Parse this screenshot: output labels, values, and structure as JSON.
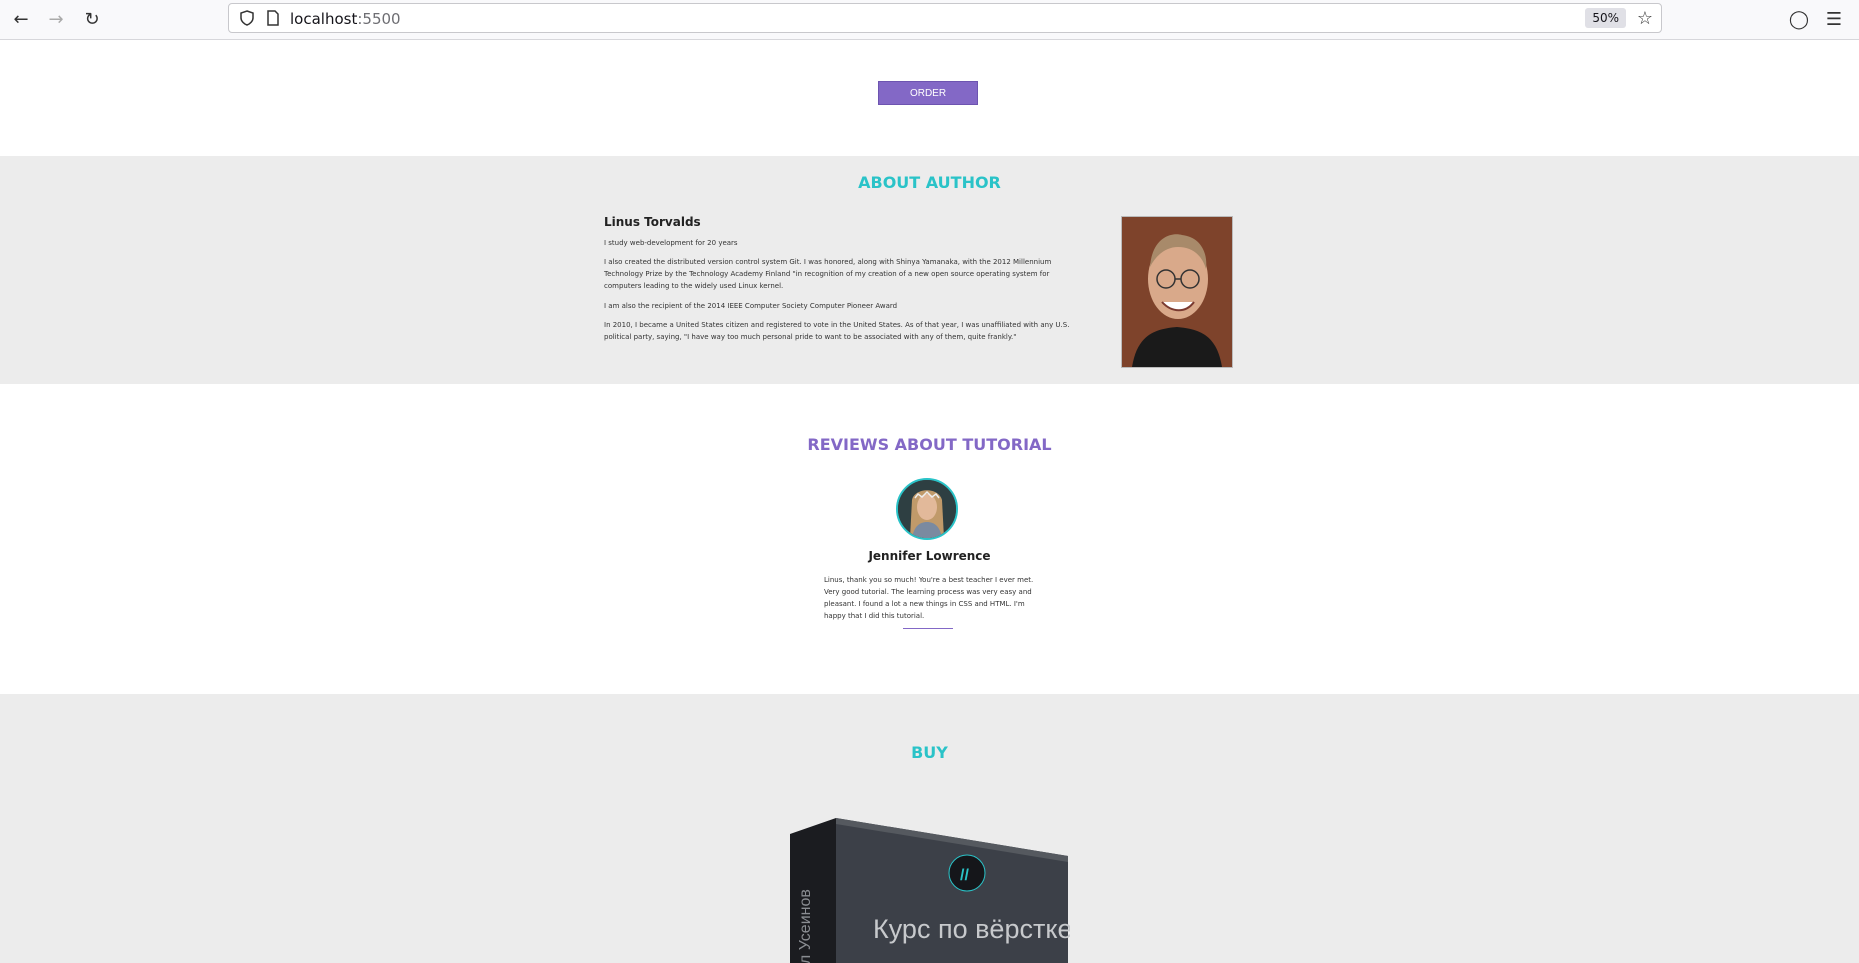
{
  "browser": {
    "url_host": "localhost",
    "url_port": ":5500",
    "zoom": "50%"
  },
  "order": {
    "label": "ORDER"
  },
  "about": {
    "title": "ABOUT AUTHOR",
    "name": "Linus Torvalds",
    "paragraphs": [
      "I study web-development for 20 years",
      "I also created the distributed version control system Git. I was honored, along with Shinya Yamanaka, with the 2012 Millennium Technology Prize by the Technology Academy Finland \"in recognition of my creation of a new open source operating system for computers leading to the widely used Linux kernel.",
      "I am also the recipient of the 2014 IEEE Computer Society Computer Pioneer Award",
      "In 2010, I became a United States citizen and registered to vote in the United States. As of that year, I was unaffiliated with any U.S. political party, saying, \"I have way too much personal pride to want to be associated with any of them, quite frankly.\""
    ]
  },
  "reviews": {
    "title": "REVIEWS ABOUT TUTORIAL",
    "name": "Jennifer Lowrence",
    "text": "Linus, thank you so much! You're a best teacher I ever met. Very good tutorial. The learning process was very easy and pleasant. I found a lot a new things in CSS and HTML. I'm happy that I did this tutorial."
  },
  "buy": {
    "title": "BUY",
    "box_title": "Курс по вёрстке",
    "box_side": "ил Усеинов"
  },
  "colors": {
    "accent_teal": "#2ac3c8",
    "accent_purple": "#8368c6",
    "section_gray": "#ececec"
  }
}
